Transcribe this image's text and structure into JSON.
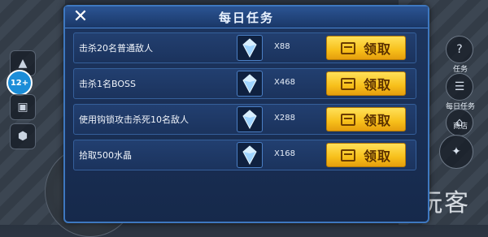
{
  "dialog": {
    "title": "每日任务"
  },
  "tasks": [
    {
      "description": "击杀20名普通敌人",
      "reward_icon": "crystal-icon",
      "reward_count": "X88",
      "claim_label": "领取"
    },
    {
      "description": "击杀1名BOSS",
      "reward_icon": "crystal-icon",
      "reward_count": "X468",
      "claim_label": "领取"
    },
    {
      "description": "使用钩锁攻击杀死10名敌人",
      "reward_icon": "crystal-icon",
      "reward_count": "X288",
      "claim_label": "领取"
    },
    {
      "description": "拾取500水晶",
      "reward_icon": "crystal-icon",
      "reward_count": "X168",
      "claim_label": "领取"
    }
  ],
  "hud": {
    "age_rating": "12+",
    "right_labels": [
      "任务",
      "每日任务",
      "商店"
    ]
  },
  "watermark": "大玩客",
  "colors": {
    "dialog_bg": "#1d3660",
    "dialog_border": "#3e78c0",
    "claim_button": "#f7bf1a",
    "claim_text": "#5a3000"
  }
}
